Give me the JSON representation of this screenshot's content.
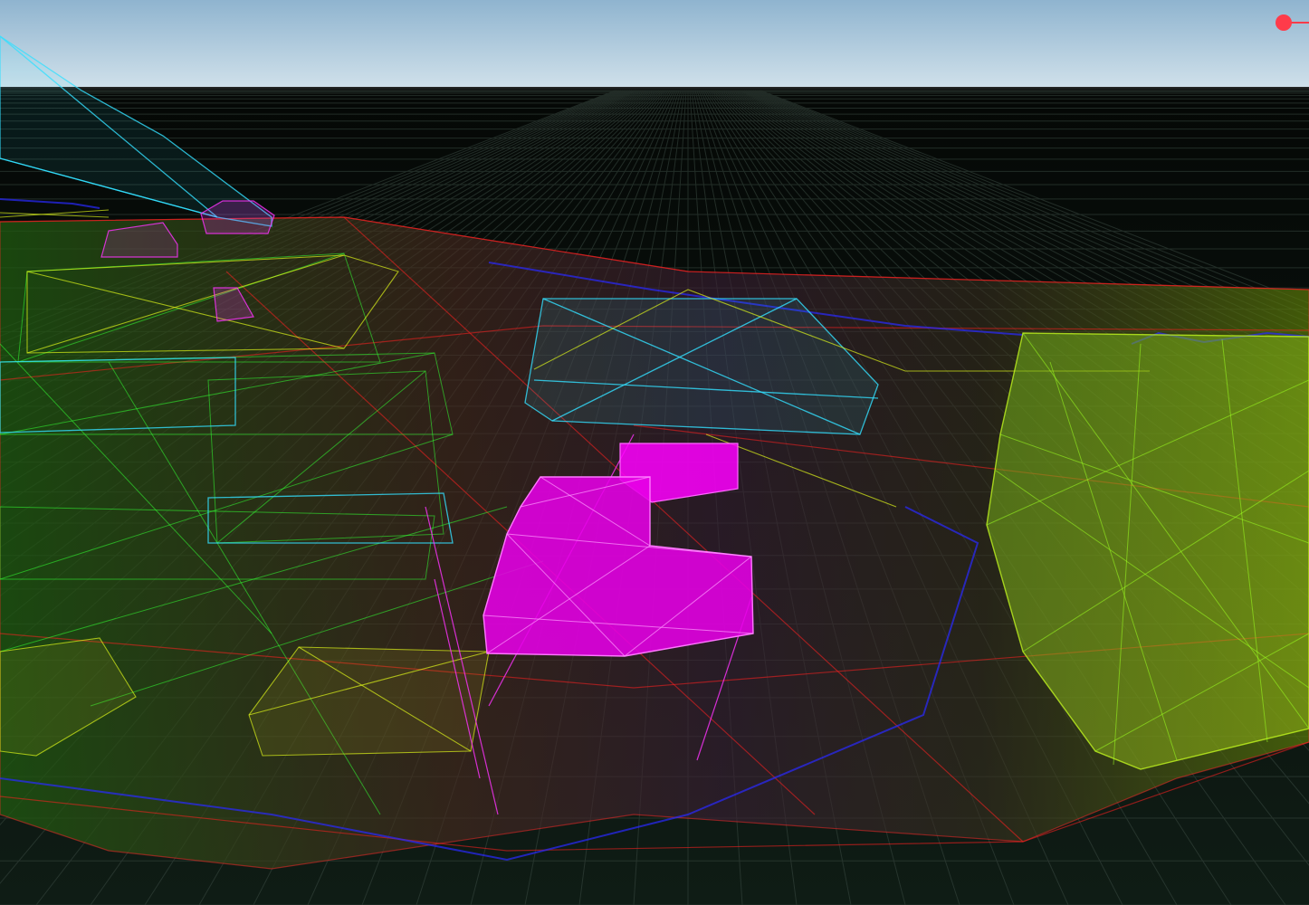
{
  "viewport": {
    "mode": "wireframe",
    "colors": {
      "sky_top": "#8fb4cf",
      "sky_bottom": "#cfe0ea",
      "ground": "#0d1a12",
      "grid": "#3a4a42",
      "magenta": "#ff00ff",
      "cyan": "#33e0ff",
      "green": "#33ff33",
      "yellow": "#e6ff1a",
      "red": "#ff2020",
      "blue": "#2a2aff",
      "gizmo_x": "#ff3b4a"
    }
  },
  "gizmo": {
    "axis": "x-axis",
    "color": "#ff3b4a"
  }
}
